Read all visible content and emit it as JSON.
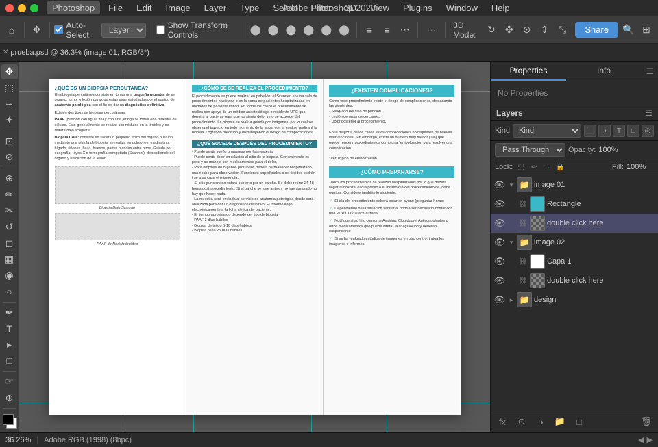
{
  "app": {
    "name": "Photoshop",
    "title": "Adobe Photoshop 2023",
    "document_tab": "prueba.psd @ 36.3% (image 01, RGB/8*)"
  },
  "menubar": {
    "apple": "⌘",
    "items": [
      "Photoshop",
      "File",
      "Edit",
      "Image",
      "Layer",
      "Type",
      "Select",
      "Filter",
      "3D",
      "View",
      "Plugins",
      "Window",
      "Help"
    ]
  },
  "toolbar": {
    "auto_select_label": "Auto-Select:",
    "auto_select_value": "Layer",
    "show_transform": "Show Transform Controls",
    "mode_3d": "3D Mode:",
    "more_label": "···",
    "share_label": "Share"
  },
  "properties_panel": {
    "tab1": "Properties",
    "tab2": "Info",
    "no_properties": "No Properties"
  },
  "layers_panel": {
    "title": "Layers",
    "filter_label": "Kind",
    "blend_mode": "Pass Through",
    "opacity_label": "Opacity:",
    "opacity_value": "100%",
    "lock_label": "Lock:",
    "fill_label": "Fill:",
    "fill_value": "100%",
    "layers": [
      {
        "id": "image01-group",
        "type": "group",
        "name": "image 01",
        "visible": true,
        "expanded": true,
        "indent": 0,
        "children": [
          {
            "id": "rectangle",
            "type": "shape",
            "name": "Rectangle",
            "visible": true,
            "indent": 1
          },
          {
            "id": "dbl-click-1",
            "type": "smart",
            "name": "double click here",
            "visible": true,
            "indent": 1,
            "selected": true
          }
        ]
      },
      {
        "id": "image02-group",
        "type": "group",
        "name": "image 02",
        "visible": true,
        "expanded": true,
        "indent": 0,
        "children": [
          {
            "id": "capa1",
            "type": "layer",
            "name": "Capa 1",
            "visible": true,
            "indent": 1
          },
          {
            "id": "dbl-click-2",
            "type": "smart",
            "name": "double click here",
            "visible": true,
            "indent": 1
          }
        ]
      },
      {
        "id": "design-group",
        "type": "group",
        "name": "design",
        "visible": true,
        "expanded": false,
        "indent": 0,
        "children": []
      }
    ],
    "bottom_icons": [
      "fx",
      "circle-half",
      "rect-outline",
      "folder",
      "trash"
    ]
  },
  "canvas": {
    "zoom": "36.26%",
    "color_profile": "Adobe RGB (1998) (8bpc)"
  },
  "document_content": {
    "left_panel": {
      "title": "¿QUÉ ES UN BIOPSIA PERCUTANEA?",
      "body": "Una biopsia percutánea consiste en tomar una pequeña muestra de un órgano, tumor o lesión para que estas sean estudiadas por el equipo de anatomía patológica con el fin de dar un diagnóstico definitivo.\n\nExisten dos tipos de biopsias percutáneas:\n\nPAAF (punción con aguja fina): con una jeringa se tomar una muestra de células. Esto generalmente se realiza con nódulos en la tiroides y se realiza bajo ecografía.\n\nBiopsia Core: consiste en sacar un pequeño trozo del órgano o lesión mediante una pistola de biopsia, se realiza en pulmones, mediastino, hígado, riñones, bazo, huesos, partes blandas entre otros. Guiado por ecografía, rayos X o tomografía computada (Scanner), dependiendo del órgano y ubicación de la lesión.",
      "label1": "Biopsia Bajo Scanner",
      "label2": "PAAF de Nódulo tiroideo"
    },
    "center_panel": {
      "title": "¿CÓMO SE SE REALIZA EL PROCEDIMIENTO?",
      "body": "El procedimiento se puede realizar en pabellón, el Scanner, en una sala de procedimientos habilitada o en la cama de pacientes hospitalizadas en unidades de paciente crítico.\n\nEn todos los casos el procedimiento se realiza con apoyo de un médico anestesiólogo o residente UPC que dormirá al paciente para que no sienta dolor y no se acuerde del procedimiento.\n\nLa biopsia se realiza guiada por imágenes, por lo cual se observa el trayecto en todo momento de la aguja con la cual se realizará la biopsia. Logrando precisión y disminuyendo el riesgo de complicaciones.",
      "subtitle": "¿QUÉ SUCEDE DESPUÉS DEL PROCEDIMIENTO?",
      "after": "- Puede sentir sueño o náuseas por la anestesia.\n- Puede sentir dolor en relación al sitio de la biopsia. Generalmente es poco y se maneja con medicamentos para el dolor.\n- Para biopsias de órganos profundos deberá permanecer hospitalizado una noche para observación. Funciones superficiales o de tiroides podrán irse a su casa el mismo día.\n- Si sitio puncionado estará cubierto por un parche. Se debe retirar 24-48 horas post-procedimiento. Si el parche se sale antes y no hay sangrado no hay que hacer nada.\n- La muestra será enviada al servicio de anatomía patológica donde será analizada para dar un diagnóstico definitivo. El informe llegó electrónicamente a la ficha clínica del paciente.\n- El tiempo aproximado depende del tipo de biopsia:\n - PAAF 3 días hábiles\n - Biopsia de tejido 5-10 días hábiles\n - Biopsia ósea 25 días hábiles"
    },
    "right_panel": {
      "title1": "¿EXISTEN COMPLICACIONES?",
      "body1": "Como todo procedimiento existe el riesgo de complicaciones, destacando las siguientes:\n- Sangrado del sitio de punción.\n- Lesión de órganos cercanos.\n- Dolor posterior al procedimiento.\n\nEn la mayoría de los casos estas complicaciones no requieren de nuevas intervenciones. Sin embargo, existe un número muy menor (1%) que puede requerir procedimientos como una \"embolización para resolver una complicación.\n\n*Ver Trípico de embolización",
      "title2": "¿CÓMO PREPARARSE?",
      "body2": "Todos los procedimientos se realizan hospitalizados por lo que deberá llegar al hospital el día previo o el mismo día del procedimiento de forma puntual. Considere también lo siguiente:",
      "checks": [
        "El día del procedimiento deberá estar en ayuno (preguntar horas)",
        "Dependiendo de la situación sanitaria, podría ser necesario contar con una PCR COVID actualizada",
        "Notifique si su hijo consume Aspirina, Clopidogrel Anticoagulantes u otros medicamentos que puede alterar la coagulación y deberán suspenderse",
        "Si se ha realizado estudios de imágenes en otro centro, traiga los imágenes e informes."
      ]
    }
  }
}
